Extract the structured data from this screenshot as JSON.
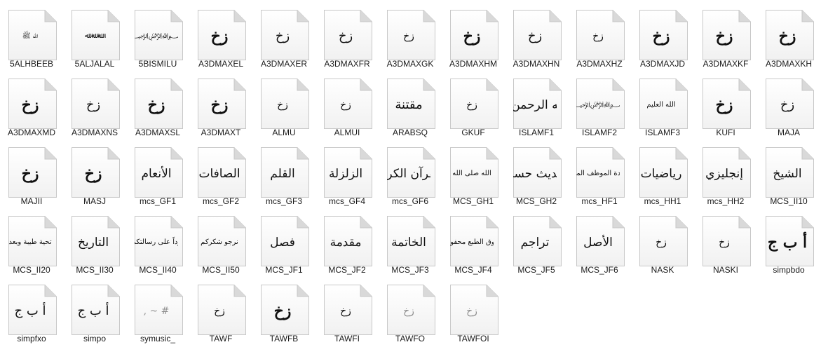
{
  "colors": {
    "page_fold": "#d9d9d9",
    "page_edge": "#c8c8c8",
    "page_fill": "#ffffff",
    "text": "#1a1a1a"
  },
  "icon_type": "font-file-icon",
  "files": [
    {
      "name": "5ALHBEEB",
      "preview": "ﷲ ﷺ",
      "style": "calligraphy-small"
    },
    {
      "name": "5ALJALAL",
      "preview": "ﷲ ﷲ ﷲ",
      "style": "calligraphy-small"
    },
    {
      "name": "5BISMILU",
      "preview": "﷽",
      "style": "calligraphy-small"
    },
    {
      "name": "A3DMAXEL",
      "preview": "زخ",
      "style": "bold"
    },
    {
      "name": "A3DMAXER",
      "preview": "زخ",
      "style": "normal"
    },
    {
      "name": "A3DMAXFR",
      "preview": "زخ",
      "style": "normal"
    },
    {
      "name": "A3DMAXGK",
      "preview": "زخ",
      "style": "small"
    },
    {
      "name": "A3DMAXHM",
      "preview": "زخ",
      "style": "bold"
    },
    {
      "name": "A3DMAXHN",
      "preview": "زخ",
      "style": "normal"
    },
    {
      "name": "A3DMAXHZ",
      "preview": "زخ",
      "style": "small"
    },
    {
      "name": "A3DMAXJD",
      "preview": "زخ",
      "style": "bold"
    },
    {
      "name": "A3DMAXKF",
      "preview": "زخ",
      "style": "bold"
    },
    {
      "name": "A3DMAXKH",
      "preview": "زخ",
      "style": "bold"
    },
    {
      "name": "A3DMAXMD",
      "preview": "زخ",
      "style": "bold"
    },
    {
      "name": "A3DMAXNS",
      "preview": "زخ",
      "style": "normal"
    },
    {
      "name": "A3DMAXSL",
      "preview": "زخ",
      "style": "bold"
    },
    {
      "name": "A3DMAXT",
      "preview": "زخ",
      "style": "bold"
    },
    {
      "name": "ALMU",
      "preview": "زخ",
      "style": "small"
    },
    {
      "name": "ALMUI",
      "preview": "زخ",
      "style": "small"
    },
    {
      "name": "ARABSQ",
      "preview": "مقتنة",
      "style": "normal"
    },
    {
      "name": "GKUF",
      "preview": "زخ",
      "style": "small"
    },
    {
      "name": "ISLAMF1",
      "preview": "بسم الله الرحمن الرحيم",
      "style": "calligraphy"
    },
    {
      "name": "ISLAMF2",
      "preview": "﷽",
      "style": "calligraphy-small"
    },
    {
      "name": "ISLAMF3",
      "preview": "الله العليم",
      "style": "calligraphy-small"
    },
    {
      "name": "KUFI",
      "preview": "زخ",
      "style": "bold"
    },
    {
      "name": "MAJA",
      "preview": "زخ",
      "style": "normal"
    },
    {
      "name": "MAJII",
      "preview": "زخ",
      "style": "bold"
    },
    {
      "name": "MASJ",
      "preview": "زخ",
      "style": "bold"
    },
    {
      "name": "mcs_GF1",
      "preview": "الأنعام",
      "style": "calligraphy"
    },
    {
      "name": "mcs_GF2",
      "preview": "الصافات",
      "style": "calligraphy"
    },
    {
      "name": "mcs_GF3",
      "preview": "القلم",
      "style": "calligraphy"
    },
    {
      "name": "mcs_GF4",
      "preview": "الزلزلة",
      "style": "calligraphy"
    },
    {
      "name": "mcs_GF6",
      "preview": "القرآن الكريم",
      "style": "calligraphy"
    },
    {
      "name": "MCS_GH1",
      "preview": "قال رسول الله صلى الله عليه وسلم",
      "style": "calligraphy-small"
    },
    {
      "name": "MCS_GH2",
      "preview": "حديث حسن",
      "style": "calligraphy"
    },
    {
      "name": "mcs_HF1",
      "preview": "شهادة الموظف المثالي",
      "style": "calligraphy-small"
    },
    {
      "name": "mcs_HH1",
      "preview": "رياضيات",
      "style": "calligraphy"
    },
    {
      "name": "mcs_HH2",
      "preview": "إنجليزي",
      "style": "calligraphy"
    },
    {
      "name": "MCS_II10",
      "preview": "الشيخ",
      "style": "calligraphy"
    },
    {
      "name": "MCS_II20",
      "preview": "تحية طيبة وبعد",
      "style": "calligraphy-small"
    },
    {
      "name": "MCS_II30",
      "preview": "التاريخ",
      "style": "calligraphy"
    },
    {
      "name": "MCS_II40",
      "preview": "رداً على رسالتكم",
      "style": "calligraphy-small"
    },
    {
      "name": "MCS_II50",
      "preview": "نرجو شكركم",
      "style": "calligraphy-small"
    },
    {
      "name": "MCS_JF1",
      "preview": "فصل",
      "style": "calligraphy"
    },
    {
      "name": "MCS_JF2",
      "preview": "مقدمة",
      "style": "calligraphy"
    },
    {
      "name": "MCS_JF3",
      "preview": "الخاتمة",
      "style": "calligraphy"
    },
    {
      "name": "MCS_JF4",
      "preview": "حقوق الطبع محفوظة",
      "style": "calligraphy-small"
    },
    {
      "name": "MCS_JF5",
      "preview": "تراجم",
      "style": "calligraphy"
    },
    {
      "name": "MCS_JF6",
      "preview": "الأصل",
      "style": "calligraphy"
    },
    {
      "name": "NASK",
      "preview": "زخ",
      "style": "small"
    },
    {
      "name": "NASKI",
      "preview": "زخ",
      "style": "small"
    },
    {
      "name": "simpbdo",
      "preview": "أ ب ج",
      "style": "bold"
    },
    {
      "name": "simpfxo",
      "preview": "أ  ب  ج",
      "style": "normal"
    },
    {
      "name": "simpo",
      "preview": "أ ب ج",
      "style": "normal"
    },
    {
      "name": "symusic_",
      "preview": "# ~ ,",
      "style": "faint"
    },
    {
      "name": "TAWF",
      "preview": "زخ",
      "style": "small"
    },
    {
      "name": "TAWFB",
      "preview": "زخ",
      "style": "bold"
    },
    {
      "name": "TAWFI",
      "preview": "زخ",
      "style": "small"
    },
    {
      "name": "TAWFO",
      "preview": "زخ",
      "style": "faint"
    },
    {
      "name": "TAWFOI",
      "preview": "زخ",
      "style": "faint"
    }
  ]
}
